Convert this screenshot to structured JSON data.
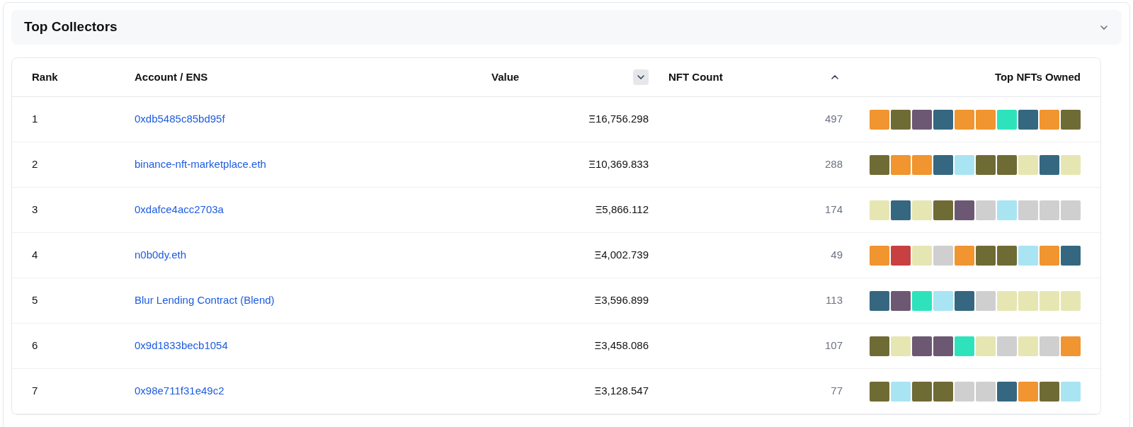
{
  "section": {
    "title": "Top Collectors",
    "expanded": true
  },
  "columns": [
    {
      "label": "Rank"
    },
    {
      "label": "Account / ENS"
    },
    {
      "label": "Value",
      "descending": true,
      "active": true
    },
    {
      "label": "NFT Count",
      "descending": false,
      "active": false
    },
    {
      "label": "Top NFTs Owned"
    }
  ],
  "rows": [
    {
      "rank": "1",
      "account": "0xdb5485c85bd95f",
      "value": "Ξ16,756.298",
      "count": "497",
      "nfts": [
        {
          "color": "#f0952f"
        },
        {
          "color": "#6f6b35"
        },
        {
          "color": "#6d5873"
        },
        {
          "color": "#356780"
        },
        {
          "color": "#f0952f"
        },
        {
          "color": "#f0952f"
        },
        {
          "color": "#2ee3bc"
        },
        {
          "color": "#356780"
        },
        {
          "color": "#f0952f"
        },
        {
          "color": "#6f6b35"
        }
      ]
    },
    {
      "rank": "2",
      "account": "binance-nft-marketplace.eth",
      "value": "Ξ10,369.833",
      "count": "288",
      "nfts": [
        {
          "color": "#6f6b35"
        },
        {
          "color": "#f0952f"
        },
        {
          "color": "#f0952f"
        },
        {
          "color": "#356780"
        },
        {
          "color": "#a9e4f3"
        },
        {
          "color": "#6f6b35"
        },
        {
          "color": "#6f6b35"
        },
        {
          "color": "#e6e6b3"
        },
        {
          "color": "#356780"
        },
        {
          "color": "#e6e6b3"
        }
      ]
    },
    {
      "rank": "3",
      "account": "0xdafce4acc2703a",
      "value": "Ξ5,866.112",
      "count": "174",
      "nfts": [
        {
          "color": "#e6e6b3"
        },
        {
          "color": "#356780"
        },
        {
          "color": "#e6e6b3"
        },
        {
          "color": "#6f6b35"
        },
        {
          "color": "#6d5873"
        },
        {
          "color": "#cfcfcf"
        },
        {
          "color": "#a9e4f3"
        },
        {
          "color": "#cfcfcf"
        },
        {
          "color": "#cfcfcf"
        },
        {
          "color": "#cfcfcf"
        }
      ]
    },
    {
      "rank": "4",
      "account": "n0b0dy.eth",
      "value": "Ξ4,002.739",
      "count": "49",
      "nfts": [
        {
          "color": "#f0952f"
        },
        {
          "color": "#c94040"
        },
        {
          "color": "#e6e6b3"
        },
        {
          "color": "#cfcfcf"
        },
        {
          "color": "#f0952f"
        },
        {
          "color": "#6f6b35"
        },
        {
          "color": "#6f6b35"
        },
        {
          "color": "#a9e4f3"
        },
        {
          "color": "#f0952f"
        },
        {
          "color": "#356780"
        }
      ]
    },
    {
      "rank": "5",
      "account": "Blur Lending Contract (Blend)",
      "value": "Ξ3,596.899",
      "count": "113",
      "nfts": [
        {
          "color": "#356780"
        },
        {
          "color": "#6d5873"
        },
        {
          "color": "#2ee3bc"
        },
        {
          "color": "#a9e4f3"
        },
        {
          "color": "#356780"
        },
        {
          "color": "#cfcfcf"
        },
        {
          "color": "#e6e6b3"
        },
        {
          "color": "#e6e6b3"
        },
        {
          "color": "#e6e6b3"
        },
        {
          "color": "#e6e6b3"
        }
      ]
    },
    {
      "rank": "6",
      "account": "0x9d1833becb1054",
      "value": "Ξ3,458.086",
      "count": "107",
      "nfts": [
        {
          "color": "#6f6b35"
        },
        {
          "color": "#e6e6b3"
        },
        {
          "color": "#6d5873"
        },
        {
          "color": "#6d5873"
        },
        {
          "color": "#2ee3bc"
        },
        {
          "color": "#e6e6b3"
        },
        {
          "color": "#cfcfcf"
        },
        {
          "color": "#e6e6b3"
        },
        {
          "color": "#cfcfcf"
        },
        {
          "color": "#f0952f"
        }
      ]
    },
    {
      "rank": "7",
      "account": "0x98e711f31e49c2",
      "value": "Ξ3,128.547",
      "count": "77",
      "nfts": [
        {
          "color": "#6f6b35"
        },
        {
          "color": "#a9e4f3"
        },
        {
          "color": "#6f6b35"
        },
        {
          "color": "#6f6b35"
        },
        {
          "color": "#cfcfcf"
        },
        {
          "color": "#cfcfcf"
        },
        {
          "color": "#356780"
        },
        {
          "color": "#f0952f"
        },
        {
          "color": "#6f6b35"
        },
        {
          "color": "#a9e4f3"
        }
      ]
    }
  ]
}
